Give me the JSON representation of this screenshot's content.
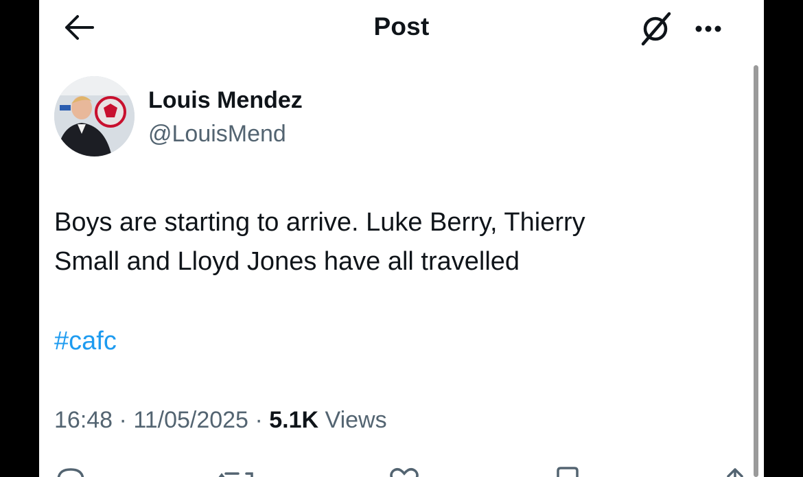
{
  "header": {
    "title": "Post",
    "back_icon": "arrow-left-icon",
    "grok_icon": "grok-icon",
    "more_icon": "more-horizontal-icon"
  },
  "post": {
    "author": {
      "display_name": "Louis Mendez",
      "handle": "@LouisMend"
    },
    "text_line1": "Boys are starting to arrive. Luke Berry, Thierry",
    "text_line2": "Small and Lloyd Jones have all travelled",
    "hashtag": "#cafc",
    "time": "16:48",
    "date": "11/05/2025",
    "views_count": "5.1K",
    "views_label": "Views",
    "separator": "·"
  },
  "colors": {
    "accent": "#1d9bf0",
    "text_primary": "#0f1419",
    "text_secondary": "#536471"
  },
  "action_icons": [
    "reply-icon",
    "repost-icon",
    "like-icon",
    "bookmark-icon",
    "share-icon"
  ]
}
